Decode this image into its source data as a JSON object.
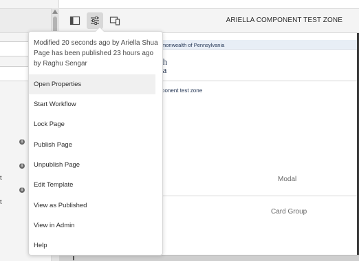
{
  "toolbar": {
    "zone_title": "ARIELLA COMPONENT TEST ZONE",
    "buttons": [
      {
        "icon": "page-info-icon"
      },
      {
        "icon": "properties-icon"
      },
      {
        "icon": "emulator-icon"
      }
    ]
  },
  "page_info": {
    "modified": "Modified 20 seconds ago by Ariella Shua",
    "published_line1": "Page has been published 23 hours ago",
    "published_line2": "by Raghu Sengar"
  },
  "menu": {
    "items": [
      {
        "label": "Open Properties"
      },
      {
        "label": "Start Workflow"
      },
      {
        "label": "Lock Page"
      },
      {
        "label": "Publish Page"
      },
      {
        "label": "Unpublish Page"
      },
      {
        "label": "Edit Template"
      },
      {
        "label": "View as Published"
      },
      {
        "label": "View in Admin"
      },
      {
        "label": "Help"
      }
    ]
  },
  "canvas": {
    "banner": "monwealth of Pennsylvania",
    "brand_line1": "th",
    "brand_line2": "ia",
    "zone_link": "ponent test zone",
    "modal_label": "Modal",
    "card_group_label": "Card Group"
  },
  "left_panel": {
    "label_a": "t",
    "label_b": "t"
  },
  "colors": {
    "accent_selection": "#d8d8d8",
    "banner_bg": "#e8eef6",
    "text_dark": "#2c2c2c"
  }
}
